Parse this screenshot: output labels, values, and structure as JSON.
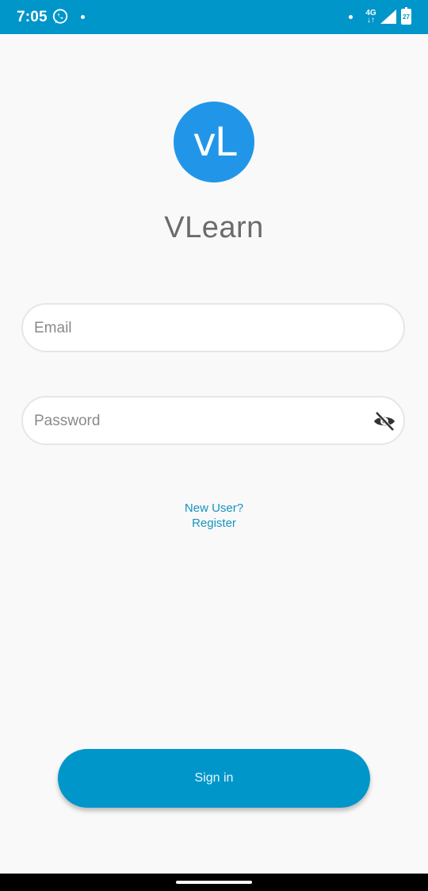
{
  "status_bar": {
    "time": "7:05",
    "network": "4G",
    "battery": "27",
    "bg_color": "#0196c9"
  },
  "logo": {
    "text": "vL",
    "color": "#2196e8"
  },
  "app_name": "VLearn",
  "form": {
    "email_placeholder": "Email",
    "email_value": "",
    "password_placeholder": "Password",
    "password_value": ""
  },
  "links": {
    "new_user": "New User?",
    "register": "Register"
  },
  "sign_in_label": "Sign in",
  "icons": [
    "whatsapp-icon",
    "signal-icon",
    "battery-icon",
    "eye-off-icon",
    "home-handle"
  ]
}
